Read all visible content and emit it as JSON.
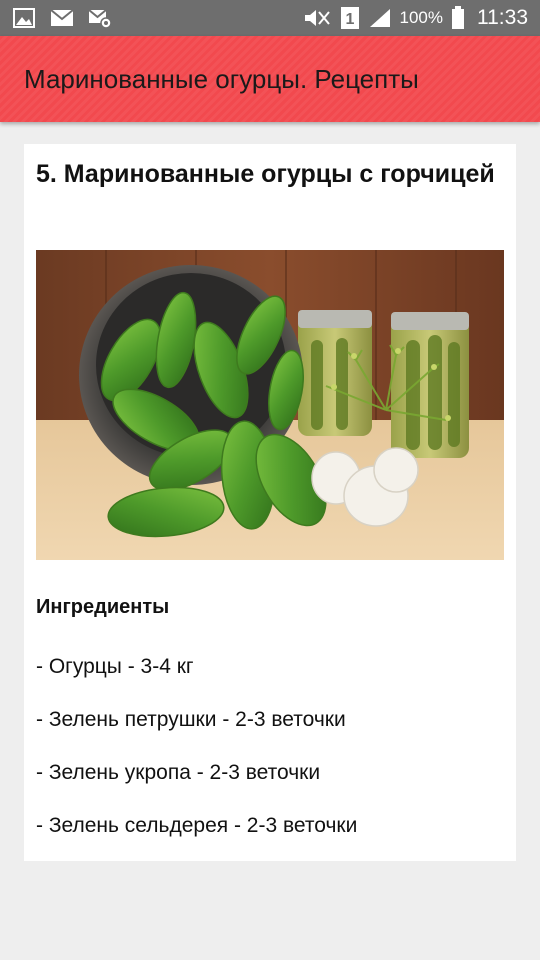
{
  "status_bar": {
    "battery_percent": "100%",
    "time": "11:33",
    "sim_slot": "1"
  },
  "app_bar": {
    "title": "Маринованные огурцы. Рецепты"
  },
  "article": {
    "title": "5. Маринованные огурцы с горчицей",
    "image_subject": "cucumbers-in-bowl-with-pickle-jars-dill-garlic",
    "ingredients_heading": "Ингредиенты",
    "ingredients": [
      "- Огурцы - 3-4 кг",
      "- Зелень петрушки - 2-3 веточки",
      "- Зелень укропа - 2-3 веточки",
      "- Зелень сельдерея - 2-3 веточки"
    ]
  },
  "colors": {
    "app_bar": "#f2494e",
    "status_bar": "#6e6e6e",
    "background": "#eeeeee",
    "card": "#ffffff"
  }
}
